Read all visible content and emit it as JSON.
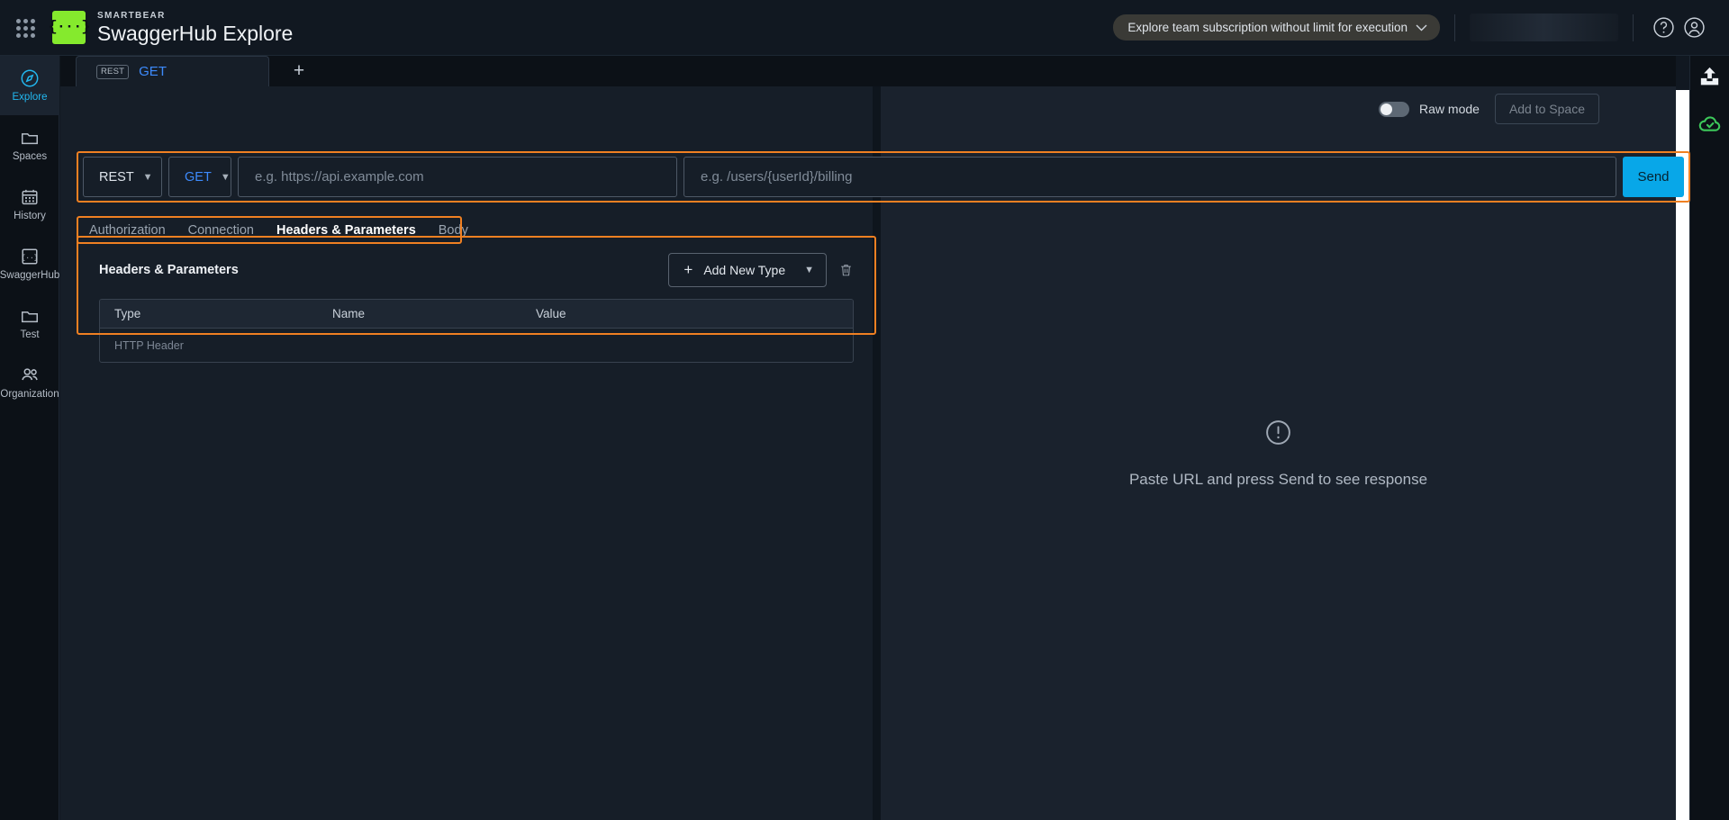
{
  "topbar": {
    "apps_icon": "grid-apps-icon",
    "logo_glyph": "{···}",
    "brand_sub": "SMARTBEAR",
    "brand_main": "SwaggerHub Explore",
    "subscription_label": "Explore team subscription without limit for execution",
    "help_icon": "help-circle-icon",
    "account_icon": "user-account-icon"
  },
  "rail": {
    "items": [
      {
        "label": "Explore",
        "icon": "compass-icon",
        "active": true
      },
      {
        "label": "Spaces",
        "icon": "folder-icon",
        "active": false
      },
      {
        "label": "History",
        "icon": "calendar-icon",
        "active": false
      },
      {
        "label": "SwaggerHub",
        "icon": "swaggerhub-icon",
        "active": false
      },
      {
        "label": "Test",
        "icon": "folder-icon",
        "active": false
      },
      {
        "label": "Organization",
        "icon": "people-icon",
        "active": false
      }
    ]
  },
  "right_rail": {
    "upload_icon": "upload-icon",
    "cloud_icon": "cloud-check-icon"
  },
  "tabstrip": {
    "request_tab": {
      "badge": "REST",
      "method": "GET"
    },
    "new_tab_label": "+"
  },
  "toolbar": {
    "raw_mode_label": "Raw mode",
    "raw_mode_on": false,
    "add_to_space_label": "Add to Space"
  },
  "urlbar": {
    "protocol": "REST",
    "method": "GET",
    "url_value": "",
    "url_placeholder": "e.g. https://api.example.com",
    "path_value": "",
    "path_placeholder": "e.g. /users/{userId}/billing",
    "send_label": "Send"
  },
  "section_tabs": [
    {
      "label": "Authorization",
      "active": false
    },
    {
      "label": "Connection",
      "active": false
    },
    {
      "label": "Headers & Parameters",
      "active": true
    },
    {
      "label": "Body",
      "active": false
    }
  ],
  "headers_panel": {
    "title": "Headers & Parameters",
    "add_new_type_label": "Add New Type",
    "add_icon": "plus-icon",
    "dropdown_icon": "chevron-down-icon",
    "delete_icon": "trash-icon",
    "columns": [
      "Type",
      "Name",
      "Value"
    ],
    "rows": [
      {
        "type": "HTTP Header",
        "name": "",
        "value": ""
      }
    ]
  },
  "response_panel": {
    "icon": "exclamation-circle-icon",
    "message": "Paste URL and press Send to see response"
  },
  "colors": {
    "accent_blue": "#08a7e8",
    "highlight_orange": "#f08022",
    "brand_green": "#85ea2d",
    "method_blue": "#3d8bfd",
    "active_rail": "#22b8f0"
  }
}
